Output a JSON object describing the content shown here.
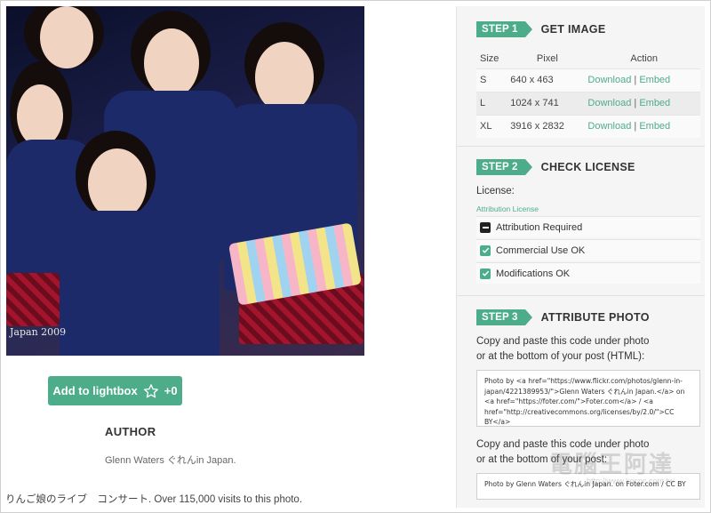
{
  "photo": {
    "caption": "Japan 2009"
  },
  "lightbox": {
    "label": "Add to lightbox",
    "count": "+0"
  },
  "author": {
    "heading": "AUTHOR",
    "name": "Glenn Waters ぐれんin Japan."
  },
  "description": "りんご娘のライブ　コンサート. Over 115,000 visits to this photo.",
  "step1": {
    "badge": "STEP 1",
    "title": "GET IMAGE",
    "headers": [
      "Size",
      "Pixel",
      "Action"
    ],
    "rows": [
      {
        "size": "S",
        "pixel": "640 x 463",
        "download": "Download",
        "sep": "|",
        "embed": "Embed"
      },
      {
        "size": "L",
        "pixel": "1024 x 741",
        "download": "Download",
        "sep": "|",
        "embed": "Embed"
      },
      {
        "size": "XL",
        "pixel": "3916 x 2832",
        "download": "Download",
        "sep": "|",
        "embed": "Embed"
      }
    ]
  },
  "step2": {
    "badge": "STEP 2",
    "title": "CHECK LICENSE",
    "license_label": "License:",
    "license_link": "Attribution License",
    "items": [
      {
        "label": "Attribution Required",
        "state": "minus"
      },
      {
        "label": "Commercial Use OK",
        "state": "ok"
      },
      {
        "label": "Modifications OK",
        "state": "ok"
      }
    ]
  },
  "step3": {
    "badge": "STEP 3",
    "title": "ATTRIBUTE PHOTO",
    "instruction_html_1": "Copy and paste this code under photo",
    "instruction_html_2": "or at the bottom of your post (HTML):",
    "code_html": "Photo by <a href=\"https://www.flickr.com/photos/glenn-in-japan/4221389953/\">Glenn Waters ぐれんin Japan.</a> on <a href=\"https://foter.com/\">Foter.com</a> / <a href=\"http://creativecommons.org/licenses/by/2.0/\">CC BY</a>",
    "instruction_text_1": "Copy and paste this code under photo",
    "instruction_text_2": "or at the bottom of your post:",
    "code_text": "Photo by Glenn Waters ぐれんin Japan. on Foter.com / CC BY"
  },
  "colors": {
    "accent": "#4dad8a",
    "panel_bg": "#f5f5f5"
  },
  "watermark": {
    "main": "電腦王阿達",
    "sub": "http://www.kocpc.com.tw"
  }
}
